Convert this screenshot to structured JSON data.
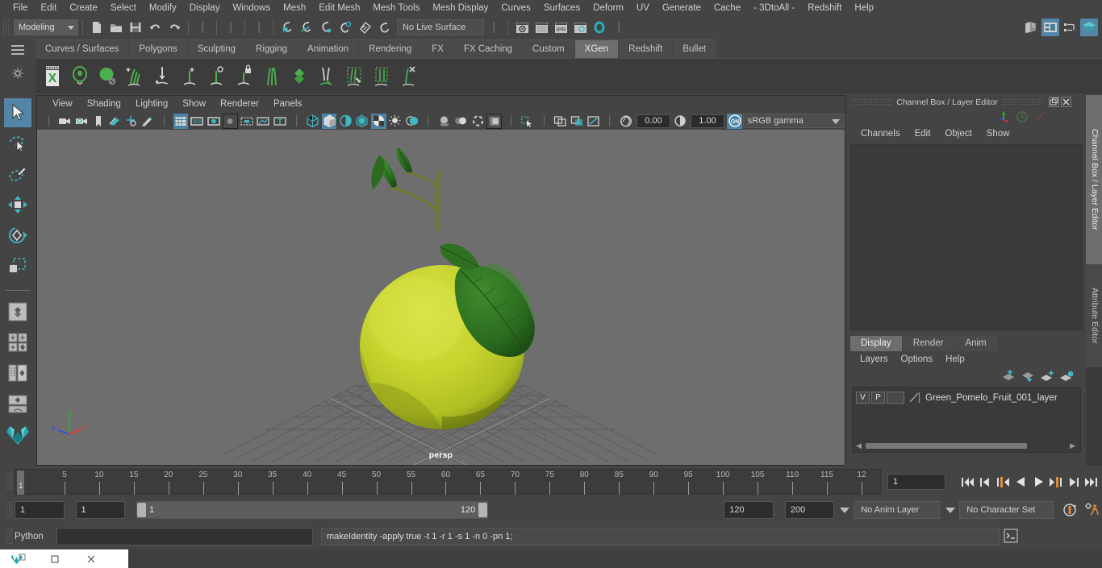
{
  "menubar": {
    "items": [
      "File",
      "Edit",
      "Create",
      "Select",
      "Modify",
      "Display",
      "Windows",
      "Mesh",
      "Edit Mesh",
      "Mesh Tools",
      "Mesh Display",
      "Curves",
      "Surfaces",
      "Deform",
      "UV",
      "Generate",
      "Cache",
      "- 3DtoAll -",
      "Redshift",
      "Help"
    ]
  },
  "statusline": {
    "mode": "Modeling",
    "live_surface": "No Live Surface",
    "icons": [
      "new-scene-icon",
      "open-scene-icon",
      "save-scene-icon",
      "undo-icon",
      "redo-icon",
      "select-by-hierarchy-icon",
      "select-by-object-icon",
      "select-by-component-icon",
      "snap-to-grid-icon",
      "snap-to-curve-icon",
      "snap-to-point-icon",
      "snap-to-projected-center-icon",
      "snap-to-view-planes-icon",
      "make-live-icon",
      "render-view-icon",
      "render-current-frame-icon",
      "ipr-render-icon",
      "render-settings-icon",
      "hypershade-icon"
    ],
    "right_icons": [
      "show-hide-editors-icon",
      "attribute-editor-toggle-icon",
      "tool-settings-toggle-icon",
      "channel-box-toggle-icon"
    ]
  },
  "shelf": {
    "tabs": [
      "Curves / Surfaces",
      "Polygons",
      "Sculpting",
      "Rigging",
      "Animation",
      "Rendering",
      "FX",
      "FX Caching",
      "Custom",
      "XGen",
      "Redshift",
      "Bullet"
    ],
    "active_tab": "XGen",
    "icons": [
      "xgen-editor-icon",
      "xgen-preview-icon",
      "xgen-sphere-icon",
      "xgen-add-grooming-icon",
      "xgen-place-icon",
      "xgen-add-guide-icon",
      "xgen-density-icon",
      "xgen-lock-guide-icon",
      "xgen-comb-icon",
      "xgen-clump-icon",
      "xgen-cut-icon",
      "xgen-sculpt-icon",
      "xgen-noise-icon",
      "xgen-delete-icon"
    ],
    "menu_icon": "shelf-menu-icon",
    "options_icon": "shelf-options-gear-icon"
  },
  "toolbox": {
    "items": [
      "select-tool",
      "lasso-select-tool",
      "paint-select-tool",
      "move-tool",
      "rotate-tool",
      "scale-tool"
    ],
    "layout_items": [
      "single-perspective-view-layout",
      "four-view-layout",
      "outliner-persp-layout",
      "hypergraph-persp-layout"
    ],
    "logo": "maya-logo-icon",
    "selected": "select-tool"
  },
  "viewport": {
    "menus": [
      "View",
      "Shading",
      "Lighting",
      "Show",
      "Renderer",
      "Panels"
    ],
    "camera_label": "persp",
    "exposure": "0.00",
    "gamma": "1.00",
    "color_management": "sRGB gamma",
    "toolbar_icons": [
      "select-camera-icon",
      "camera-attributes-icon",
      "bookmark-icon",
      "image-plane-icon",
      "2d-pan-zoom-icon",
      "grease-pencil-icon",
      "grid-toggle-icon",
      "film-gate-icon",
      "resolution-gate-icon",
      "gate-mask-icon",
      "film-origin-icon",
      "safe-action-icon",
      "texture-toggle-icon",
      "wireframe-shading-icon",
      "smooth-shading-icon",
      "shaded-wireframe-icon",
      "x-ray-icon",
      "texture-display-icon",
      "lighting-icon",
      "shadows-icon",
      "screen-space-ao-icon",
      "motion-blur-icon",
      "multisample-aa-icon",
      "isolate-select-icon",
      "grid-snap-icon",
      "xray-joints-icon",
      "xray-components-icon",
      "exposure-icon",
      "gamma-icon",
      "color-management-toggle-icon"
    ],
    "scene_description": "Green pomelo fruit 3D model with leaves on grid ground plane",
    "axis_labels": [
      "x",
      "y",
      "z"
    ],
    "axis_colors": {
      "x": "#ff2f2f",
      "y": "#22c020",
      "z": "#2f46ff"
    }
  },
  "right_panel": {
    "title": "Channel Box / Layer Editor",
    "window_buttons": [
      "undock-icon",
      "close-icon"
    ],
    "header_icons": [
      "axis-gizmo-icon",
      "dimmed-circle-icon",
      "dimmed-slash-icon"
    ],
    "channelbox_menus": [
      "Channels",
      "Edit",
      "Object",
      "Show"
    ],
    "layer_editor_tabs": [
      "Display",
      "Render",
      "Anim"
    ],
    "active_layer_tab": "Display",
    "layer_menus": [
      "Layers",
      "Options",
      "Help"
    ],
    "layer_buttons": [
      "move-layer-up-icon",
      "move-layer-down-icon",
      "create-empty-layer-icon",
      "create-layer-from-selected-icon"
    ],
    "layers": [
      {
        "visibility": "V",
        "playback": "P",
        "shading": "",
        "name": "Green_Pomelo_Fruit_001_layer"
      }
    ],
    "vertical_tabs": [
      "Channel Box / Layer Editor",
      "Attribute Editor"
    ],
    "active_vertical_tab": "Channel Box / Layer Editor"
  },
  "timeline": {
    "tick_labels": [
      "5",
      "10",
      "15",
      "20",
      "25",
      "30",
      "35",
      "40",
      "45",
      "50",
      "55",
      "60",
      "65",
      "70",
      "75",
      "80",
      "85",
      "90",
      "95",
      "100",
      "105",
      "110",
      "115",
      "12"
    ],
    "current_frame_marker": "1",
    "current_frame_field": "1",
    "playback_buttons": [
      "go-to-start-icon",
      "step-back-keyframe-icon",
      "step-back-frame-icon",
      "play-backwards-icon",
      "play-forwards-icon",
      "step-forward-frame-icon",
      "step-forward-keyframe-icon",
      "go-to-end-icon"
    ]
  },
  "range_slider": {
    "anim_start": "1",
    "range_start": "1",
    "slider_start_label": "1",
    "slider_end_label": "120",
    "range_end": "120",
    "anim_end": "200",
    "anim_layer": "No Anim Layer",
    "character_set": "No Character Set",
    "auto_key_icon": "auto-keyframe-icon",
    "anim_prefs_icon": "animation-preferences-icon"
  },
  "command_line": {
    "language_label": "Python",
    "input_value": "",
    "output_text": "makeIdentity -apply true -t 1 -r 1 -s 1 -n 0 -pn 1;",
    "script_editor_icon": "script-editor-icon"
  },
  "taskbar": {
    "buttons": [
      "maya-app-icon",
      "restore-window-icon",
      "minimize-window-icon",
      "close-window-icon"
    ]
  },
  "colors": {
    "accent_blue": "#5285a6",
    "teal_icon": "#3fb8c4",
    "shelf_green": "#4caf50",
    "panel_bg": "#444444",
    "viewport_bg": "#6e6e6e",
    "fruit_green": "#c2cf2a",
    "leaf_green": "#2f6d22",
    "orange_marker": "#e08a3c"
  }
}
